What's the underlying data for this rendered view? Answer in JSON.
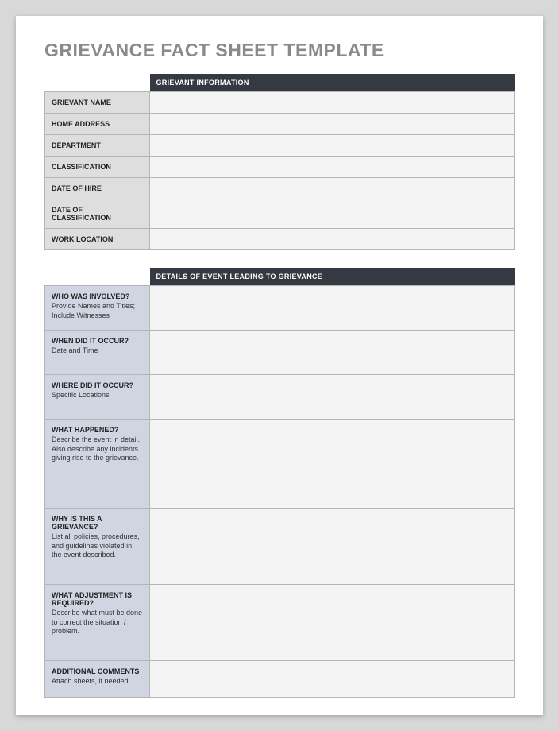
{
  "title": "GRIEVANCE FACT SHEET TEMPLATE",
  "section1": {
    "header": "GRIEVANT INFORMATION",
    "rows": [
      {
        "label": "GRIEVANT NAME",
        "value": ""
      },
      {
        "label": "HOME ADDRESS",
        "value": ""
      },
      {
        "label": "DEPARTMENT",
        "value": ""
      },
      {
        "label": "CLASSIFICATION",
        "value": ""
      },
      {
        "label": "DATE OF HIRE",
        "value": ""
      },
      {
        "label": "DATE OF CLASSIFICATION",
        "value": ""
      },
      {
        "label": "WORK LOCATION",
        "value": ""
      }
    ]
  },
  "section2": {
    "header": "DETAILS OF EVENT LEADING TO GRIEVANCE",
    "rows": [
      {
        "label": "WHO WAS INVOLVED?",
        "sub": "Provide Names and Titles; Include Witnesses",
        "value": "",
        "h": "row-h-sm"
      },
      {
        "label": "WHEN DID IT OCCUR?",
        "sub": "Date and Time",
        "value": "",
        "h": "row-h-md"
      },
      {
        "label": "WHERE DID IT OCCUR?",
        "sub": "Specific Locations",
        "value": "",
        "h": "row-h-md"
      },
      {
        "label": "WHAT HAPPENED?",
        "sub": "Describe the event in detail. Also describe any incidents giving rise to the grievance.",
        "value": "",
        "h": "row-h-lg"
      },
      {
        "label": "WHY IS THIS A GRIEVANCE?",
        "sub": "List all policies, procedures, and guidelines violated in the event described.",
        "value": "",
        "h": "row-h-xl"
      },
      {
        "label": "WHAT ADJUSTMENT IS REQUIRED?",
        "sub": "Describe what must be done to correct the situation / problem.",
        "value": "",
        "h": "row-h-xl"
      },
      {
        "label": "ADDITIONAL COMMENTS",
        "sub": "Attach sheets, if needed",
        "value": "",
        "h": "row-h-comments"
      }
    ]
  }
}
